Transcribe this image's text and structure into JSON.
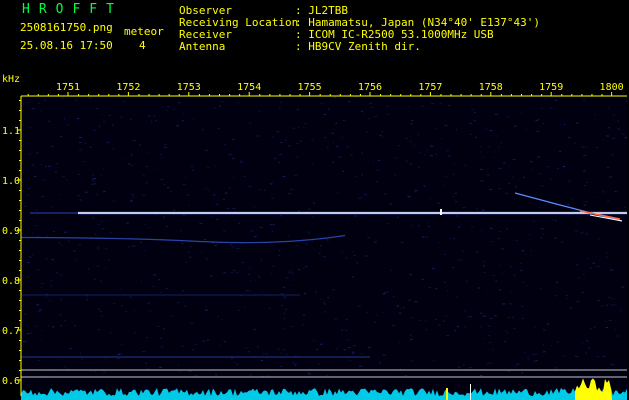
{
  "app": {
    "logo": "HROFFT",
    "filename": "2508161750.png",
    "datetime": "25.08.16 17:50",
    "counter_label": "meteor",
    "counter_value": "4"
  },
  "station": {
    "observer_label": "Observer",
    "observer_value": ": JL2TBB",
    "location_label": "Receiving Location",
    "location_value": ": Hamamatsu, Japan (N34°40' E137°43')",
    "receiver_label": "Receiver",
    "receiver_value": ": ICOM IC-R2500 53.1000MHz USB",
    "antenna_label": "Antenna",
    "antenna_value": ": HB9CV Zenith dir."
  },
  "chart_data": {
    "type": "heatmap",
    "x_label": "",
    "y_unit": "kHz",
    "x_ticks": [
      "1751",
      "1752",
      "1753",
      "1754",
      "1755",
      "1756",
      "1757",
      "1758",
      "1759",
      "1800"
    ],
    "y_ticks": [
      "1.1",
      "1.0",
      "0.9",
      "0.8",
      "0.7",
      "0.6"
    ],
    "ylim": [
      0.6,
      1.14
    ],
    "carrier_khz": 0.93,
    "secondary_lines_khz": [
      0.885,
      0.67
    ],
    "meteor_echoes": 4,
    "colors": {
      "axis": "#ffff00",
      "carrier": "#ffffff",
      "noise": "#1a2a7a",
      "spectrum": "#00e0ff",
      "burst": "#ffff00"
    }
  }
}
